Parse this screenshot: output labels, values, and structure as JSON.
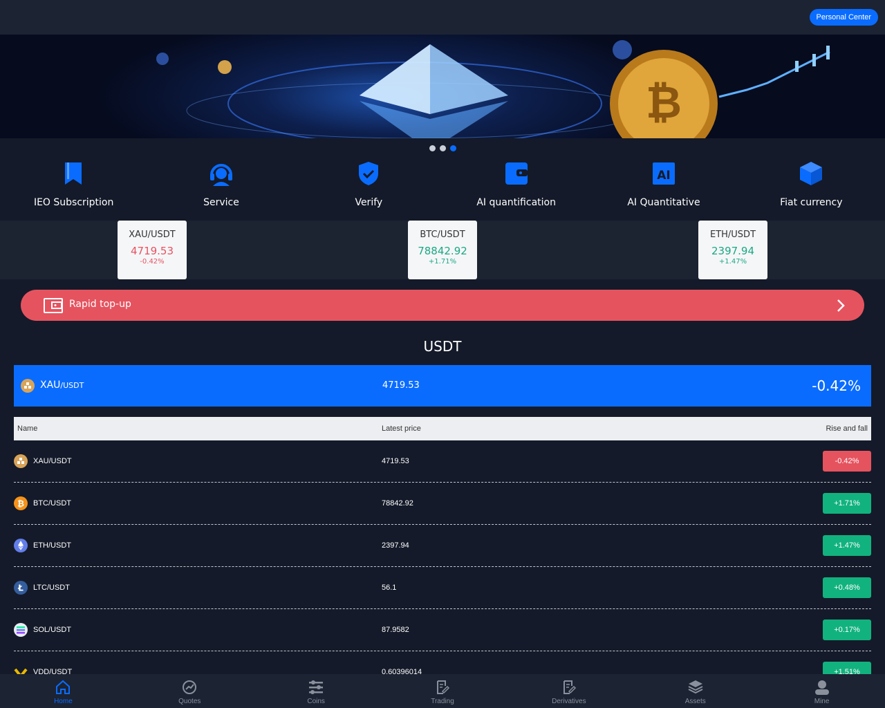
{
  "header": {
    "personal_center": "Personal Center"
  },
  "carousel": {
    "count": 3,
    "active_index": 2
  },
  "shortcuts": [
    {
      "label": "IEO Subscription",
      "icon": "bookmark-icon"
    },
    {
      "label": "Service",
      "icon": "headset-icon"
    },
    {
      "label": "Verify",
      "icon": "shield-check-icon"
    },
    {
      "label": "AI quantification",
      "icon": "wallet-icon"
    },
    {
      "label": "AI Quantitative",
      "icon": "ai-icon",
      "icon_text": "AI"
    },
    {
      "label": "Fiat currency",
      "icon": "cube-icon"
    }
  ],
  "tickers": [
    {
      "pair": "XAU/USDT",
      "price": "4719.53",
      "change": "-0.42%",
      "direction": "down"
    },
    {
      "pair": "BTC/USDT",
      "price": "78842.92",
      "change": "+1.71%",
      "direction": "up"
    },
    {
      "pair": "ETH/USDT",
      "price": "2397.94",
      "change": "+1.47%",
      "direction": "up"
    }
  ],
  "topup": {
    "label": "Rapid top-up"
  },
  "market": {
    "title": "USDT",
    "highlight": {
      "base": "XAU",
      "quote": "/USDT",
      "price": "4719.53",
      "change": "-0.42%"
    },
    "columns": {
      "name": "Name",
      "price": "Latest price",
      "change": "Rise and fall"
    },
    "rows": [
      {
        "pair": "XAU/USDT",
        "price": "4719.53",
        "change": "-0.42%",
        "direction": "down",
        "icon": "gold-icon"
      },
      {
        "pair": "BTC/USDT",
        "price": "78842.92",
        "change": "+1.71%",
        "direction": "up",
        "icon": "bitcoin-icon"
      },
      {
        "pair": "ETH/USDT",
        "price": "2397.94",
        "change": "+1.47%",
        "direction": "up",
        "icon": "ethereum-icon"
      },
      {
        "pair": "LTC/USDT",
        "price": "56.1",
        "change": "+0.48%",
        "direction": "up",
        "icon": "litecoin-icon"
      },
      {
        "pair": "SOL/USDT",
        "price": "87.9582",
        "change": "+0.17%",
        "direction": "up",
        "icon": "solana-icon"
      },
      {
        "pair": "VDD/USDT",
        "price": "0.60396014",
        "change": "+1.51%",
        "direction": "up",
        "icon": "vdd-icon"
      }
    ]
  },
  "tabs": [
    {
      "label": "Home",
      "icon": "home-icon",
      "active": true
    },
    {
      "label": "Quotes",
      "icon": "chart-icon"
    },
    {
      "label": "Coins",
      "icon": "sliders-icon"
    },
    {
      "label": "Trading",
      "icon": "edit-doc-icon"
    },
    {
      "label": "Derivatives",
      "icon": "edit-doc-icon"
    },
    {
      "label": "Assets",
      "icon": "layers-icon"
    },
    {
      "label": "Mine",
      "icon": "user-icon"
    }
  ],
  "colors": {
    "accent": "#0a6cff",
    "up": "#12b27e",
    "down": "#e5535f",
    "background": "#141a29"
  }
}
